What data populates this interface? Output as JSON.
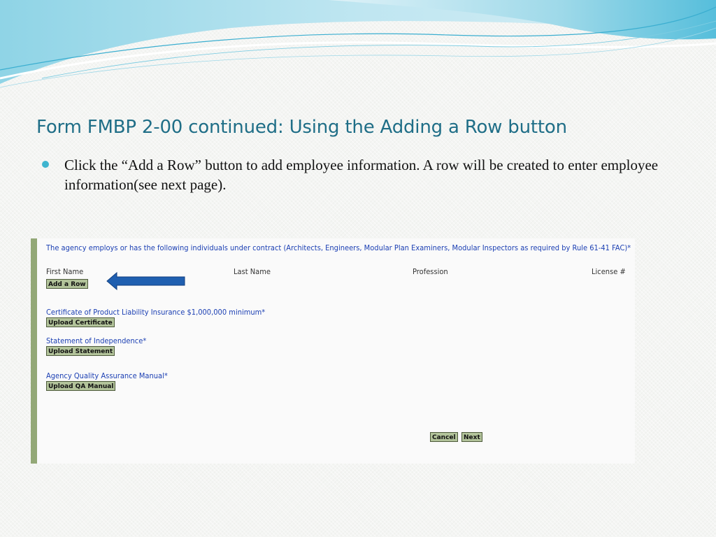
{
  "slide": {
    "title": "Form FMBP 2-00 continued: Using the Adding a Row button",
    "bullet": "Click the “Add a Row” button to add employee information. A row will be created to enter employee information(see next page)."
  },
  "screenshot": {
    "intro": "The agency employs or has the following individuals under contract (Architects, Engineers, Modular Plan Examiners, Modular Inspectors as required by Rule 61-41 FAC)*",
    "columns": [
      "First Name",
      "Last Name",
      "Profession",
      "License #"
    ],
    "add_row_label": "Add a Row",
    "certificate_label": "Certificate of Product Liability Insurance $1,000,000 minimum*",
    "upload_certificate_label": "Upload Certificate",
    "independence_label": "Statement of Independence*",
    "upload_statement_label": "Upload Statement",
    "qa_manual_label": "Agency Quality Assurance Manual*",
    "upload_qa_label": "Upload QA Manual",
    "cancel_label": "Cancel",
    "next_label": "Next"
  },
  "colors": {
    "title": "#1f6e87",
    "bullet": "#3fb5cf",
    "form_text": "#1b3fb3",
    "button_bg": "#b2c39a",
    "arrow": "#1f5fb0",
    "frame_border": "#93a877"
  },
  "icons": {
    "arrow": "left-arrow-icon"
  }
}
